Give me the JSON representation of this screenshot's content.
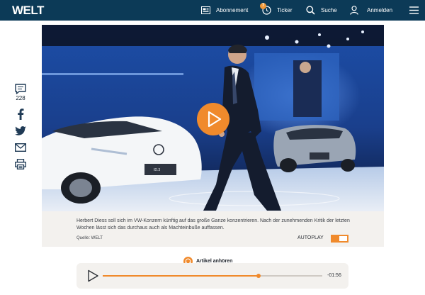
{
  "header": {
    "logo": "WELT",
    "nav": {
      "abonnement": "Abonnement",
      "ticker": "Ticker",
      "ticker_badge": "7",
      "suche": "Suche",
      "anmelden": "Anmelden"
    }
  },
  "social": {
    "comment_count": "228",
    "icons": [
      "comment-icon",
      "facebook-icon",
      "twitter-icon",
      "mail-icon",
      "print-icon"
    ]
  },
  "video": {
    "caption": "Herbert Diess soll sich im VW-Konzern künftig auf das große Ganze konzentrieren. Nach der zunehmenden Kritik der letzten Wochen lässt sich das durchaus auch als Machteinbuße auffassen.",
    "source": "Quelle: WELT",
    "autoplay_label": "AUTOPLAY",
    "autoplay_on": true,
    "car_plate": "ID.3"
  },
  "audio": {
    "label": "Artikel anhören",
    "time_remaining": "-01:56",
    "progress": 0.71
  },
  "colors": {
    "header_bg": "#0c3a57",
    "accent": "#f08a2c"
  }
}
